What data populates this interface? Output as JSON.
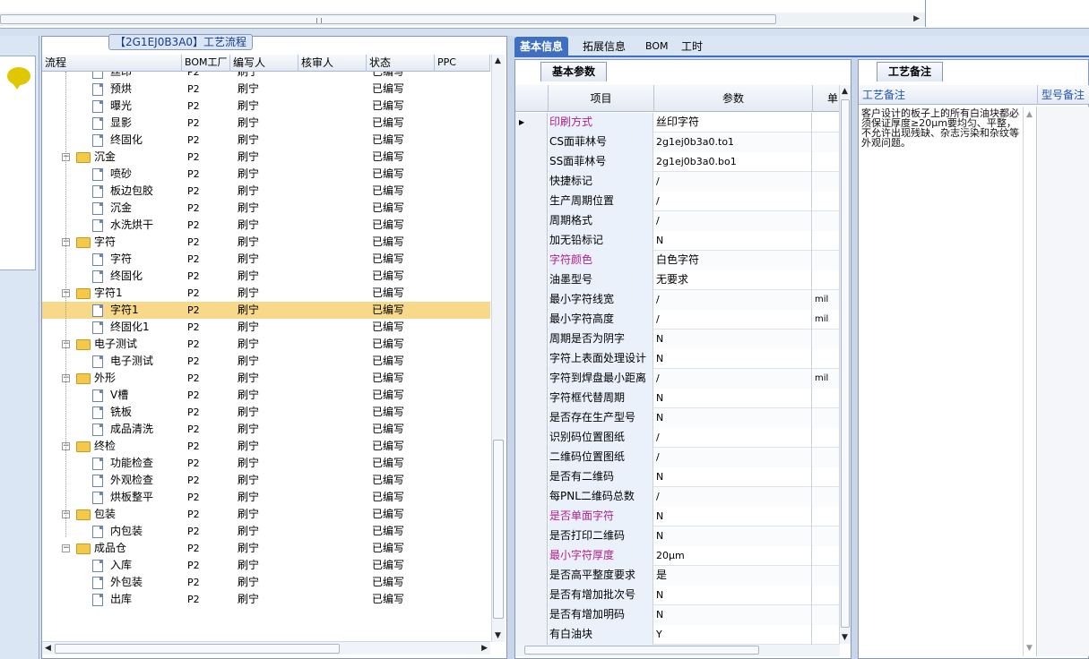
{
  "tree_panel": {
    "title": "【2G1EJ0B3A0】工艺流程",
    "columns": [
      "流程",
      "BOM工厂",
      "编写人",
      "核审人",
      "状态",
      "PPC"
    ],
    "rows": [
      {
        "name": "丝印",
        "level": 2,
        "kind": "file",
        "bom": "P2",
        "writer": "刷宁",
        "reviewer": "",
        "status": "已编写",
        "partial": true
      },
      {
        "name": "预烘",
        "level": 2,
        "kind": "file",
        "bom": "P2",
        "writer": "刷宁",
        "reviewer": "",
        "status": "已编写"
      },
      {
        "name": "曝光",
        "level": 2,
        "kind": "file",
        "bom": "P2",
        "writer": "刷宁",
        "reviewer": "",
        "status": "已编写"
      },
      {
        "name": "显影",
        "level": 2,
        "kind": "file",
        "bom": "P2",
        "writer": "刷宁",
        "reviewer": "",
        "status": "已编写"
      },
      {
        "name": "终固化",
        "level": 2,
        "kind": "file",
        "bom": "P2",
        "writer": "刷宁",
        "reviewer": "",
        "status": "已编写"
      },
      {
        "name": "沉金",
        "level": 1,
        "kind": "folder",
        "bom": "P2",
        "writer": "刷宁",
        "reviewer": "",
        "status": "已编写"
      },
      {
        "name": "喷砂",
        "level": 2,
        "kind": "file",
        "bom": "P2",
        "writer": "刷宁",
        "reviewer": "",
        "status": "已编写"
      },
      {
        "name": "板边包胶",
        "level": 2,
        "kind": "file",
        "bom": "P2",
        "writer": "刷宁",
        "reviewer": "",
        "status": "已编写"
      },
      {
        "name": "沉金",
        "level": 2,
        "kind": "file",
        "bom": "P2",
        "writer": "刷宁",
        "reviewer": "",
        "status": "已编写"
      },
      {
        "name": "水洗烘干",
        "level": 2,
        "kind": "file",
        "bom": "P2",
        "writer": "刷宁",
        "reviewer": "",
        "status": "已编写"
      },
      {
        "name": "字符",
        "level": 1,
        "kind": "folder",
        "bom": "P2",
        "writer": "刷宁",
        "reviewer": "",
        "status": "已编写"
      },
      {
        "name": "字符",
        "level": 2,
        "kind": "file",
        "bom": "P2",
        "writer": "刷宁",
        "reviewer": "",
        "status": "已编写"
      },
      {
        "name": "终固化",
        "level": 2,
        "kind": "file",
        "bom": "P2",
        "writer": "刷宁",
        "reviewer": "",
        "status": "已编写"
      },
      {
        "name": "字符1",
        "level": 1,
        "kind": "folder",
        "bom": "P2",
        "writer": "刷宁",
        "reviewer": "",
        "status": "已编写"
      },
      {
        "name": "字符1",
        "level": 2,
        "kind": "file",
        "bom": "P2",
        "writer": "刷宁",
        "reviewer": "",
        "status": "已编写",
        "selected": true
      },
      {
        "name": "终固化1",
        "level": 2,
        "kind": "file",
        "bom": "P2",
        "writer": "刷宁",
        "reviewer": "",
        "status": "已编写"
      },
      {
        "name": "电子测试",
        "level": 1,
        "kind": "folder",
        "bom": "P2",
        "writer": "刷宁",
        "reviewer": "",
        "status": "已编写"
      },
      {
        "name": "电子测试",
        "level": 2,
        "kind": "file",
        "bom": "P2",
        "writer": "刷宁",
        "reviewer": "",
        "status": "已编写"
      },
      {
        "name": "外形",
        "level": 1,
        "kind": "folder",
        "bom": "P2",
        "writer": "刷宁",
        "reviewer": "",
        "status": "已编写"
      },
      {
        "name": "V槽",
        "level": 2,
        "kind": "file",
        "bom": "P2",
        "writer": "刷宁",
        "reviewer": "",
        "status": "已编写"
      },
      {
        "name": "铣板",
        "level": 2,
        "kind": "file",
        "bom": "P2",
        "writer": "刷宁",
        "reviewer": "",
        "status": "已编写"
      },
      {
        "name": "成品清洗",
        "level": 2,
        "kind": "file",
        "bom": "P2",
        "writer": "刷宁",
        "reviewer": "",
        "status": "已编写"
      },
      {
        "name": "终检",
        "level": 1,
        "kind": "folder",
        "bom": "P2",
        "writer": "刷宁",
        "reviewer": "",
        "status": "已编写"
      },
      {
        "name": "功能检查",
        "level": 2,
        "kind": "file",
        "bom": "P2",
        "writer": "刷宁",
        "reviewer": "",
        "status": "已编写"
      },
      {
        "name": "外观检查",
        "level": 2,
        "kind": "file",
        "bom": "P2",
        "writer": "刷宁",
        "reviewer": "",
        "status": "已编写"
      },
      {
        "name": "烘板整平",
        "level": 2,
        "kind": "file",
        "bom": "P2",
        "writer": "刷宁",
        "reviewer": "",
        "status": "已编写"
      },
      {
        "name": "包装",
        "level": 1,
        "kind": "folder",
        "bom": "P2",
        "writer": "刷宁",
        "reviewer": "",
        "status": "已编写"
      },
      {
        "name": "内包装",
        "level": 2,
        "kind": "file",
        "bom": "P2",
        "writer": "刷宁",
        "reviewer": "",
        "status": "已编写"
      },
      {
        "name": "成品仓",
        "level": 1,
        "kind": "folder",
        "bom": "P2",
        "writer": "刷宁",
        "reviewer": "",
        "status": "已编写"
      },
      {
        "name": "入库",
        "level": 2,
        "kind": "file",
        "bom": "P2",
        "writer": "刷宁",
        "reviewer": "",
        "status": "已编写"
      },
      {
        "name": "外包装",
        "level": 2,
        "kind": "file",
        "bom": "P2",
        "writer": "刷宁",
        "reviewer": "",
        "status": "已编写"
      },
      {
        "name": "出库",
        "level": 2,
        "kind": "file",
        "bom": "P2",
        "writer": "刷宁",
        "reviewer": "",
        "status": "已编写"
      }
    ]
  },
  "tabs": [
    "基本信息",
    "拓展信息",
    "BOM",
    "工时"
  ],
  "active_tab": 0,
  "basic_panel": {
    "section_tab": "基本参数",
    "columns": {
      "item": "项目",
      "param": "参数",
      "unit": "单"
    },
    "rows": [
      {
        "key": "印刷方式",
        "value": "丝印字符",
        "unit": "",
        "highlight": true,
        "current": true
      },
      {
        "key": "CS面菲林号",
        "value": "2g1ej0b3a0.to1",
        "unit": ""
      },
      {
        "key": "SS面菲林号",
        "value": "2g1ej0b3a0.bo1",
        "unit": ""
      },
      {
        "key": "快捷标记",
        "value": "/",
        "unit": ""
      },
      {
        "key": "生产周期位置",
        "value": "/",
        "unit": ""
      },
      {
        "key": "周期格式",
        "value": "/",
        "unit": ""
      },
      {
        "key": "加无铅标记",
        "value": "N",
        "unit": ""
      },
      {
        "key": "字符颜色",
        "value": "白色字符",
        "unit": "",
        "highlight": true
      },
      {
        "key": "油墨型号",
        "value": "无要求",
        "unit": ""
      },
      {
        "key": "最小字符线宽",
        "value": "/",
        "unit": "mil"
      },
      {
        "key": "最小字符高度",
        "value": "/",
        "unit": "mil"
      },
      {
        "key": "周期是否为阴字",
        "value": "N",
        "unit": ""
      },
      {
        "key": "字符上表面处理设计",
        "value": "N",
        "unit": ""
      },
      {
        "key": "字符到焊盘最小距离",
        "value": "/",
        "unit": "mil"
      },
      {
        "key": "字符框代替周期",
        "value": "N",
        "unit": ""
      },
      {
        "key": "是否存在生产型号",
        "value": "N",
        "unit": ""
      },
      {
        "key": "识别码位置图纸",
        "value": "/",
        "unit": ""
      },
      {
        "key": "二维码位置图纸",
        "value": "/",
        "unit": ""
      },
      {
        "key": "是否有二维码",
        "value": "N",
        "unit": ""
      },
      {
        "key": "每PNL二维码总数",
        "value": "/",
        "unit": ""
      },
      {
        "key": "是否单面字符",
        "value": "N",
        "unit": "",
        "highlight": true
      },
      {
        "key": "是否打印二维码",
        "value": "N",
        "unit": ""
      },
      {
        "key": "最小字符厚度",
        "value": "20μm",
        "unit": "",
        "highlight": true
      },
      {
        "key": "是否高平整度要求",
        "value": "是",
        "unit": ""
      },
      {
        "key": "是否有增加批次号",
        "value": "N",
        "unit": ""
      },
      {
        "key": "是否有增加明码",
        "value": "N",
        "unit": ""
      },
      {
        "key": "有白油块",
        "value": "Y",
        "unit": ""
      }
    ]
  },
  "notes_panel": {
    "section_tab": "工艺备注",
    "columns": [
      "工艺备注",
      "型号备注"
    ],
    "note": "客户设计的板子上的所有白油块都必须保证厚度≥20μm要均匀、平整，不允许出现残缺、杂志污染和杂纹等外观问题。"
  },
  "colors": {
    "accent": "#3f6fc0",
    "selected_row": "#f8d98a",
    "highlight_key": "#b0208a"
  }
}
